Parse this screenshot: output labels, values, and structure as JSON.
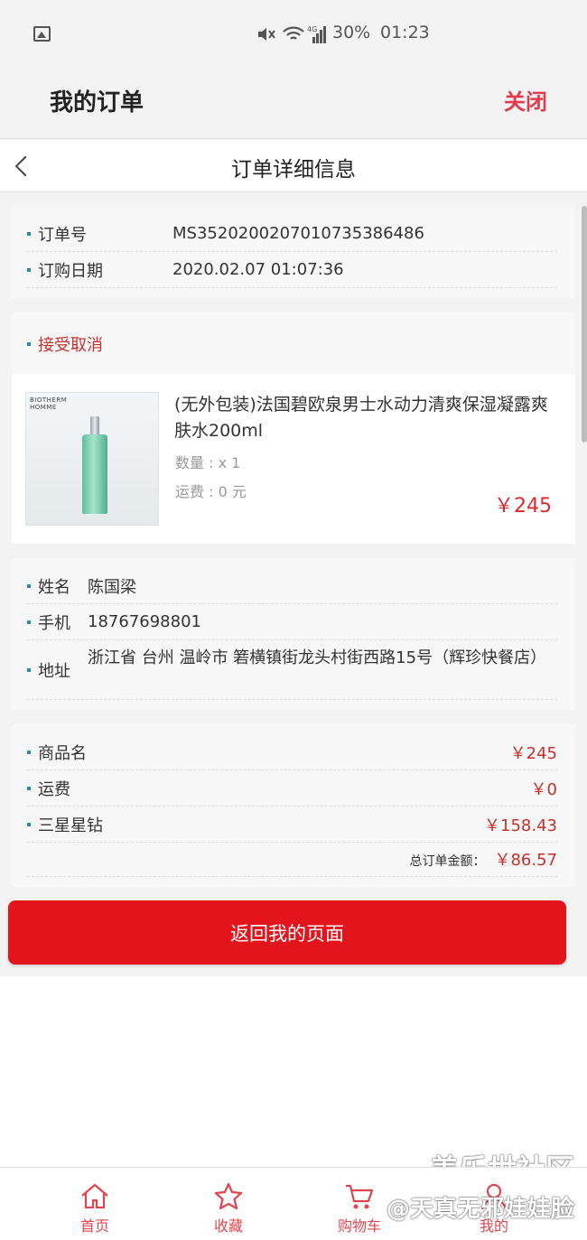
{
  "status_bar": {
    "battery": "30%",
    "time": "01:23",
    "network": "4G"
  },
  "header": {
    "title": "我的订单",
    "close_label": "关闭"
  },
  "sub_header": {
    "title": "订单详细信息"
  },
  "order": {
    "number_label": "订单号",
    "number_value": "MS3520200207010735386486",
    "date_label": "订购日期",
    "date_value": "2020.02.07 01:07:36",
    "status": "接受取消"
  },
  "product": {
    "brand_line1": "BIOTHERM",
    "brand_line2": "HOMME",
    "title": "(无外包装)法国碧欧泉男士水动力清爽保湿凝露爽肤水200ml",
    "qty": "数量 : x 1",
    "shipping": "运费 : 0 元",
    "price": "￥245"
  },
  "recipient": {
    "name_label": "姓名",
    "name_value": "陈国梁",
    "phone_label": "手机",
    "phone_value": "18767698801",
    "address_label": "地址",
    "address_value": "浙江省 台州 温岭市 箬横镇街龙头村街西路15号（辉珍快餐店）"
  },
  "summary": {
    "items": [
      {
        "label": "商品名",
        "value": "￥245"
      },
      {
        "label": "运费",
        "value": "￥0"
      },
      {
        "label": "三星星钻",
        "value": "￥158.43"
      }
    ],
    "total_label": "总订单金额：",
    "total_value": "￥86.57"
  },
  "return_button": "返回我的页面",
  "nav": [
    {
      "label": "首页",
      "icon": "home-icon"
    },
    {
      "label": "收藏",
      "icon": "star-icon"
    },
    {
      "label": "购物车",
      "icon": "cart-icon"
    },
    {
      "label": "我的",
      "icon": "user-icon"
    }
  ],
  "watermark": {
    "line1": "盖乐世社区",
    "line2": "@天真无邪娃娃脸"
  },
  "colors": {
    "accent_red": "#e3141c",
    "price_red": "#c9302c",
    "bullet_blue": "#2e86c1"
  }
}
